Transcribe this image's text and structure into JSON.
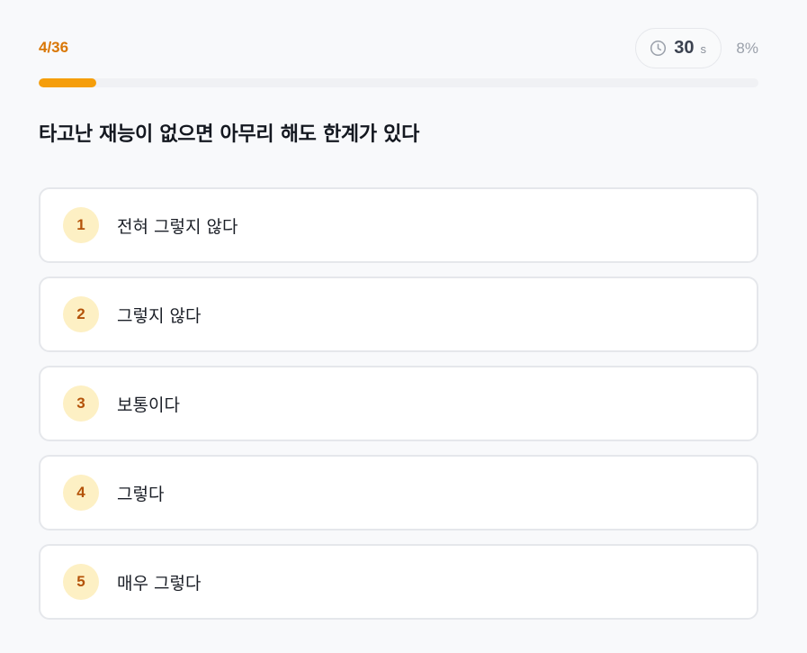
{
  "header": {
    "counter": "4/36",
    "timer_value": "30",
    "timer_unit": "s",
    "percent": "8%",
    "timer_icon": "clock-icon"
  },
  "progress": {
    "fraction": 0.08,
    "fill_color": "#f59e0b",
    "track_color": "#f0f1f4"
  },
  "question": {
    "text": "타고난 재능이 없으면 아무리 해도 한계가 있다"
  },
  "options": [
    {
      "number": "1",
      "label": "전혀 그렇지 않다"
    },
    {
      "number": "2",
      "label": "그렇지 않다"
    },
    {
      "number": "3",
      "label": "보통이다"
    },
    {
      "number": "4",
      "label": "그렇다"
    },
    {
      "number": "5",
      "label": "매우 그렇다"
    }
  ],
  "colors": {
    "accent": "#d97706",
    "badge_bg": "#fdf0c4",
    "badge_text": "#b45309"
  }
}
